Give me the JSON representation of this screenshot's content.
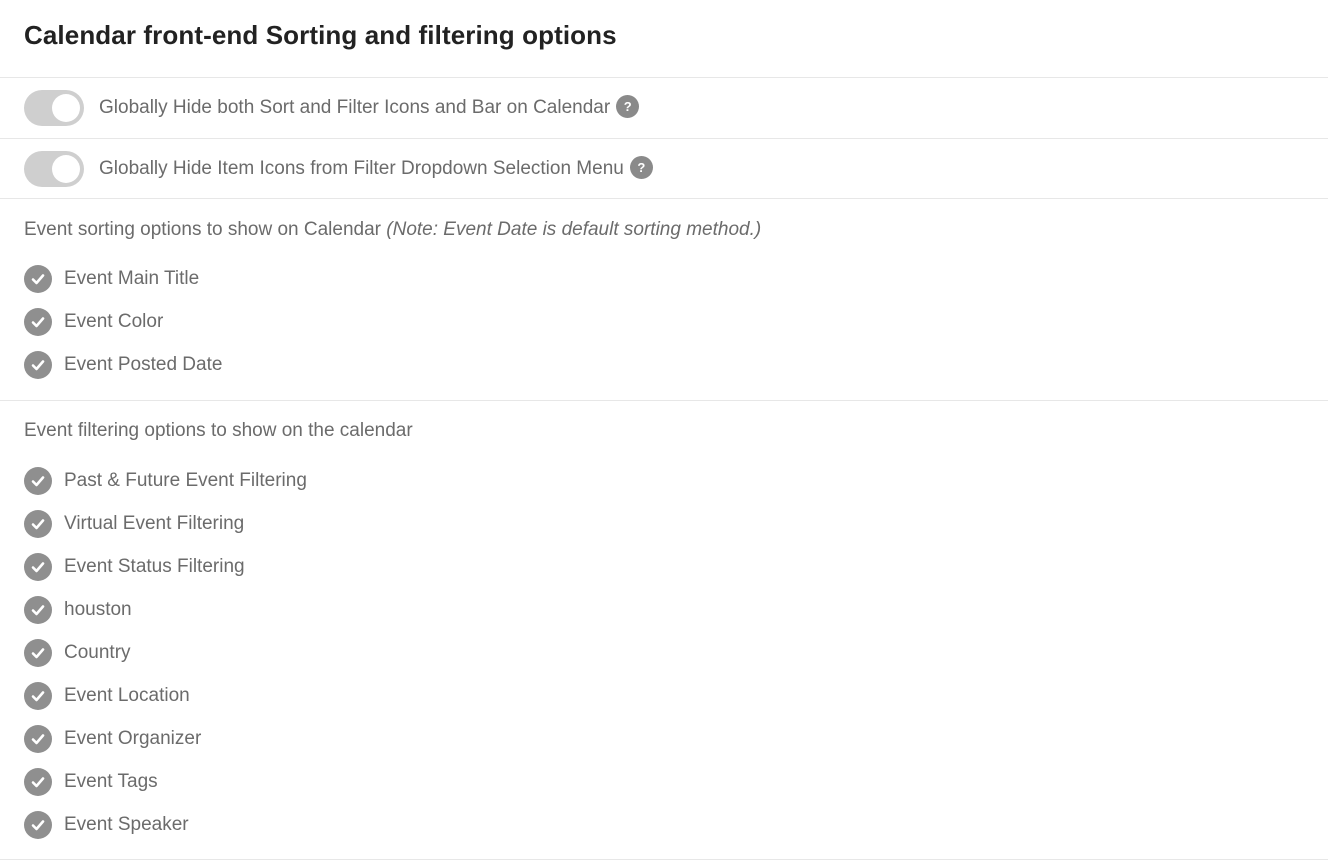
{
  "page": {
    "title": "Calendar front-end Sorting and filtering options"
  },
  "toggles": [
    {
      "label": "Globally Hide both Sort and Filter Icons and Bar on Calendar",
      "help": "?",
      "state": "on"
    },
    {
      "label": "Globally Hide Item Icons from Filter Dropdown Selection Menu",
      "help": "?",
      "state": "on"
    }
  ],
  "sorting": {
    "heading": "Event sorting options to show on Calendar",
    "note": "(Note: Event Date is default sorting method.)",
    "items": [
      "Event Main Title",
      "Event Color",
      "Event Posted Date"
    ]
  },
  "filtering": {
    "heading": "Event filtering options to show on the calendar",
    "items": [
      "Past & Future Event Filtering",
      "Virtual Event Filtering",
      "Event Status Filtering",
      "houston",
      "Country",
      "Event Location",
      "Event Organizer",
      "Event Tags",
      "Event Speaker"
    ]
  },
  "colors": {
    "toggle_track": "#cfcfcf",
    "check_circle": "#8f8f8f",
    "help_icon": "#8a8a8a",
    "title_text": "#222222",
    "body_text": "#6b6b6b"
  },
  "icons": {
    "check": "checkmark-circle-icon",
    "help": "question-mark-icon"
  }
}
